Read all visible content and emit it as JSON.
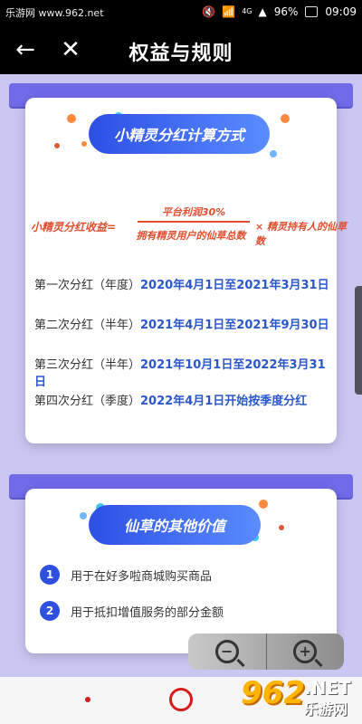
{
  "status_bar": {
    "watermark": "乐游网 www.962.net",
    "network": "4G",
    "battery": "96%",
    "time": "09:09"
  },
  "header": {
    "title": "权益与规则",
    "back_icon": "arrow-left-icon",
    "close_icon": "close-icon"
  },
  "section1": {
    "title": "小精灵分红计算方式",
    "formula": {
      "left": "小精灵分红收益=",
      "numerator": "平台利润30%",
      "denominator": "拥有精灵用户的仙草总数",
      "right": "× 精灵持有人的仙草数"
    },
    "dividends": [
      {
        "prefix": "第一次分红（年度）",
        "date": "2020年4月1日至2021年3月31日"
      },
      {
        "prefix": "第二次分红（半年）",
        "date": "2021年4月1日至2021年9月30日"
      },
      {
        "prefix": "第三次分红（半年）",
        "date": "2021年10月1日至2022年3月31日"
      },
      {
        "prefix": "第四次分红（季度）",
        "date": "2022年4月1日开始按季度分红"
      }
    ]
  },
  "section2": {
    "title": "仙草的其他价值",
    "items": [
      {
        "num": "1",
        "text": "用于在好多啦商城购买商品"
      },
      {
        "num": "2",
        "text": "用于抵扣增值服务的部分金额"
      }
    ]
  },
  "zoom": {
    "out_icon": "zoom-out-icon",
    "in_icon": "zoom-in-icon",
    "out_symbol": "−",
    "in_symbol": "+"
  },
  "watermark_logo": {
    "big": "962",
    "net": ".NET",
    "cn": "乐游网"
  },
  "colors": {
    "accent_blue": "#2f4fe0",
    "accent_red": "#e04f2f",
    "background": "#c9c6f1"
  }
}
